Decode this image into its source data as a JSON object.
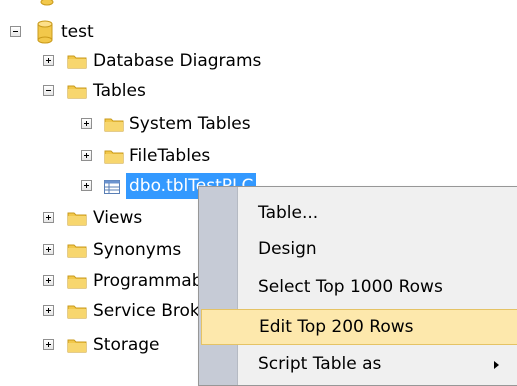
{
  "tree": {
    "database": "test",
    "nodes": [
      {
        "label": "Database Diagrams"
      },
      {
        "label": "Tables"
      },
      {
        "label": "System Tables"
      },
      {
        "label": "FileTables"
      },
      {
        "label": "dbo.tblTestPLC"
      },
      {
        "label": "Views"
      },
      {
        "label": "Synonyms"
      },
      {
        "label": "Programmability"
      },
      {
        "label": "Service Broker"
      },
      {
        "label": "Storage"
      }
    ]
  },
  "context_menu": {
    "items": [
      {
        "label": "Table..."
      },
      {
        "label": "Design"
      },
      {
        "label": "Select Top 1000 Rows"
      },
      {
        "label": "Edit Top 200 Rows"
      },
      {
        "label": "Script Table as"
      }
    ],
    "highlighted": "Edit Top 200 Rows"
  },
  "colors": {
    "folder": "#f2c84b",
    "selection": "#3399ff",
    "menu_highlight": "#fde8ac",
    "menu_gutter": "#c6cbd6"
  }
}
